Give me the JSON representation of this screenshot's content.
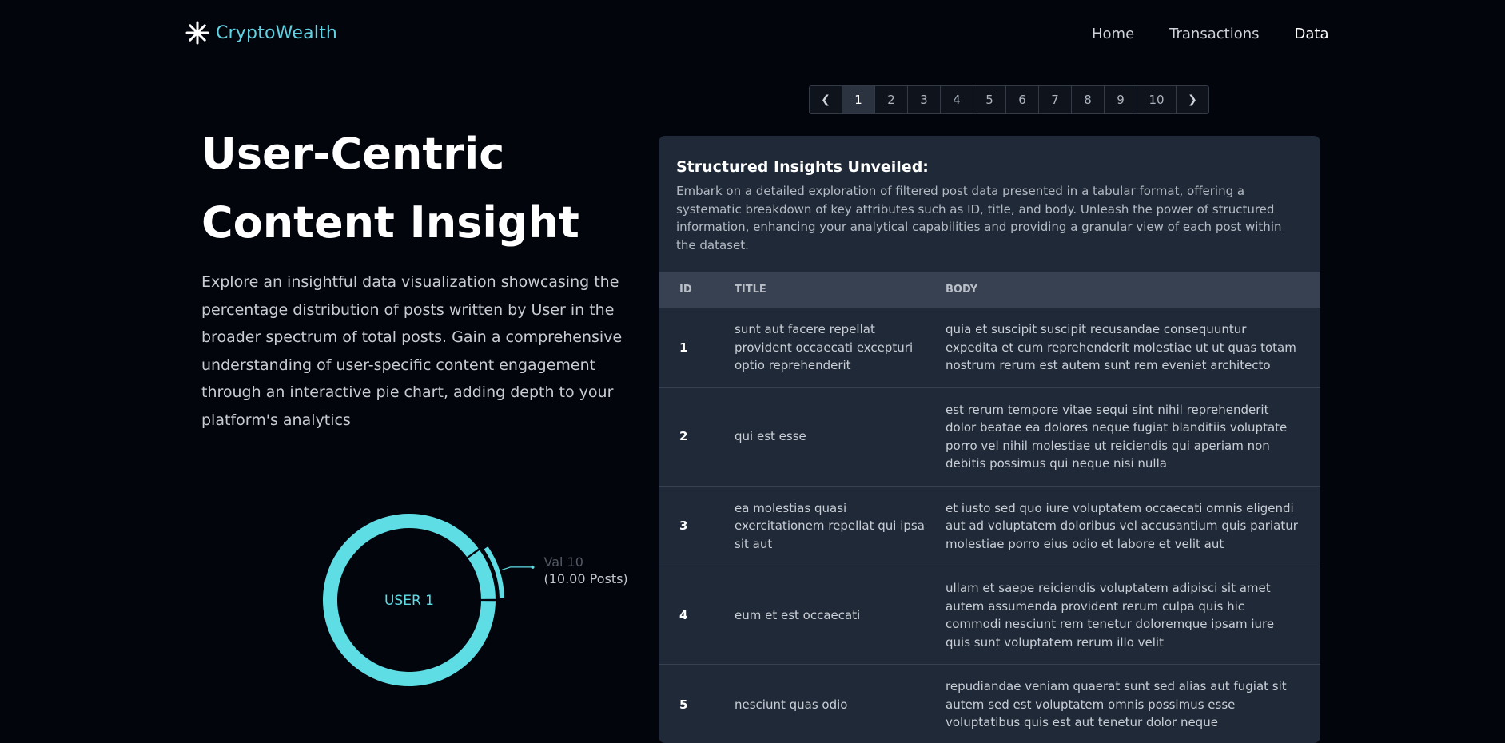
{
  "brand": {
    "name": "CryptoWealth"
  },
  "nav": {
    "items": [
      "Home",
      "Transactions",
      "Data"
    ],
    "active": "Data"
  },
  "hero": {
    "title_line1": "User-Centric",
    "title_line2": "Content Insight",
    "description": "Explore an insightful data visualization showcasing the percentage distribution of posts written by User in the broader spectrum of total posts. Gain a comprehensive understanding of user-specific content engagement through an interactive pie chart, adding depth to your platform's analytics"
  },
  "chart_data": {
    "type": "pie",
    "center_label": "USER 1",
    "slices": [
      {
        "label": "Val 10",
        "value": 10,
        "detail": "(10.00 Posts)",
        "highlighted": true
      },
      {
        "label": "",
        "value": 90,
        "detail": "",
        "highlighted": false
      }
    ],
    "colors": {
      "ring": "#5fdde5",
      "label_primary": "#545a64",
      "label_secondary": "#c4c8ce"
    }
  },
  "pagination": {
    "prev_icon": "chevron-left",
    "next_icon": "chevron-right",
    "pages": [
      "1",
      "2",
      "3",
      "4",
      "5",
      "6",
      "7",
      "8",
      "9",
      "10"
    ],
    "current": "1"
  },
  "table_card": {
    "title": "Structured Insights Unveiled:",
    "description": "Embark on a detailed exploration of filtered post data presented in a tabular format, offering a systematic breakdown of key attributes such as ID, title, and body. Unleash the power of structured information, enhancing your analytical capabilities and providing a granular view of each post within the dataset.",
    "columns": [
      "ID",
      "TITLE",
      "BODY"
    ],
    "rows": [
      {
        "id": "1",
        "title": "sunt aut facere repellat provident occaecati excepturi optio reprehenderit",
        "body": "quia et suscipit suscipit recusandae consequuntur expedita et cum reprehenderit molestiae ut ut quas totam nostrum rerum est autem sunt rem eveniet architecto"
      },
      {
        "id": "2",
        "title": "qui est esse",
        "body": "est rerum tempore vitae sequi sint nihil reprehenderit dolor beatae ea dolores neque fugiat blanditiis voluptate porro vel nihil molestiae ut reiciendis qui aperiam non debitis possimus qui neque nisi nulla"
      },
      {
        "id": "3",
        "title": "ea molestias quasi exercitationem repellat qui ipsa sit aut",
        "body": "et iusto sed quo iure voluptatem occaecati omnis eligendi aut ad voluptatem doloribus vel accusantium quis pariatur molestiae porro eius odio et labore et velit aut"
      },
      {
        "id": "4",
        "title": "eum et est occaecati",
        "body": "ullam et saepe reiciendis voluptatem adipisci sit amet autem assumenda provident rerum culpa quis hic commodi nesciunt rem tenetur doloremque ipsam iure quis sunt voluptatem rerum illo velit"
      },
      {
        "id": "5",
        "title": "nesciunt quas odio",
        "body": "repudiandae veniam quaerat sunt sed alias aut fugiat sit autem sed est voluptatem omnis possimus esse voluptatibus quis est aut tenetur dolor neque"
      }
    ]
  }
}
